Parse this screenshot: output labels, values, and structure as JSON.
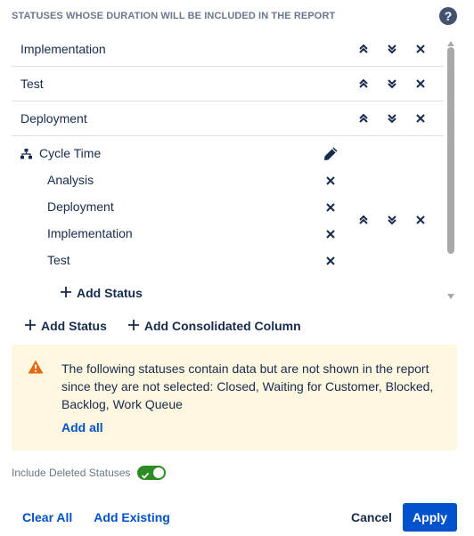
{
  "header": {
    "title": "STATUSES WHOSE DURATION WILL BE INCLUDED IN THE REPORT",
    "help_glyph": "?"
  },
  "statuses": [
    {
      "label": "Implementation"
    },
    {
      "label": "Test"
    },
    {
      "label": "Deployment"
    }
  ],
  "consolidated": {
    "label": "Cycle Time",
    "items": [
      "Analysis",
      "Deployment",
      "Implementation",
      "Test"
    ],
    "add_status_label": "Add Status"
  },
  "actions": {
    "add_status": "Add Status",
    "add_consolidated": "Add Consolidated Column"
  },
  "warning": {
    "text": "The following statuses contain data but are not shown in the report since they are not selected: Closed, Waiting for Customer, Blocked, Backlog, Work Queue",
    "link": "Add all"
  },
  "toggle": {
    "label": "Include Deleted Statuses",
    "checked": true
  },
  "footer": {
    "clear_all": "Clear All",
    "add_existing": "Add Existing",
    "cancel": "Cancel",
    "apply": "Apply"
  },
  "colors": {
    "primary": "#0052cc",
    "warning_bg": "#fff7e0",
    "warning_icon": "#e56910",
    "toggle_on": "#2c8b22"
  },
  "icons": {
    "move_up": "double-chevron-up-icon",
    "move_down": "double-chevron-down-icon",
    "remove": "close-icon",
    "edit": "pencil-icon",
    "group": "hierarchy-icon",
    "add": "plus-icon",
    "warning": "warning-triangle-icon"
  }
}
